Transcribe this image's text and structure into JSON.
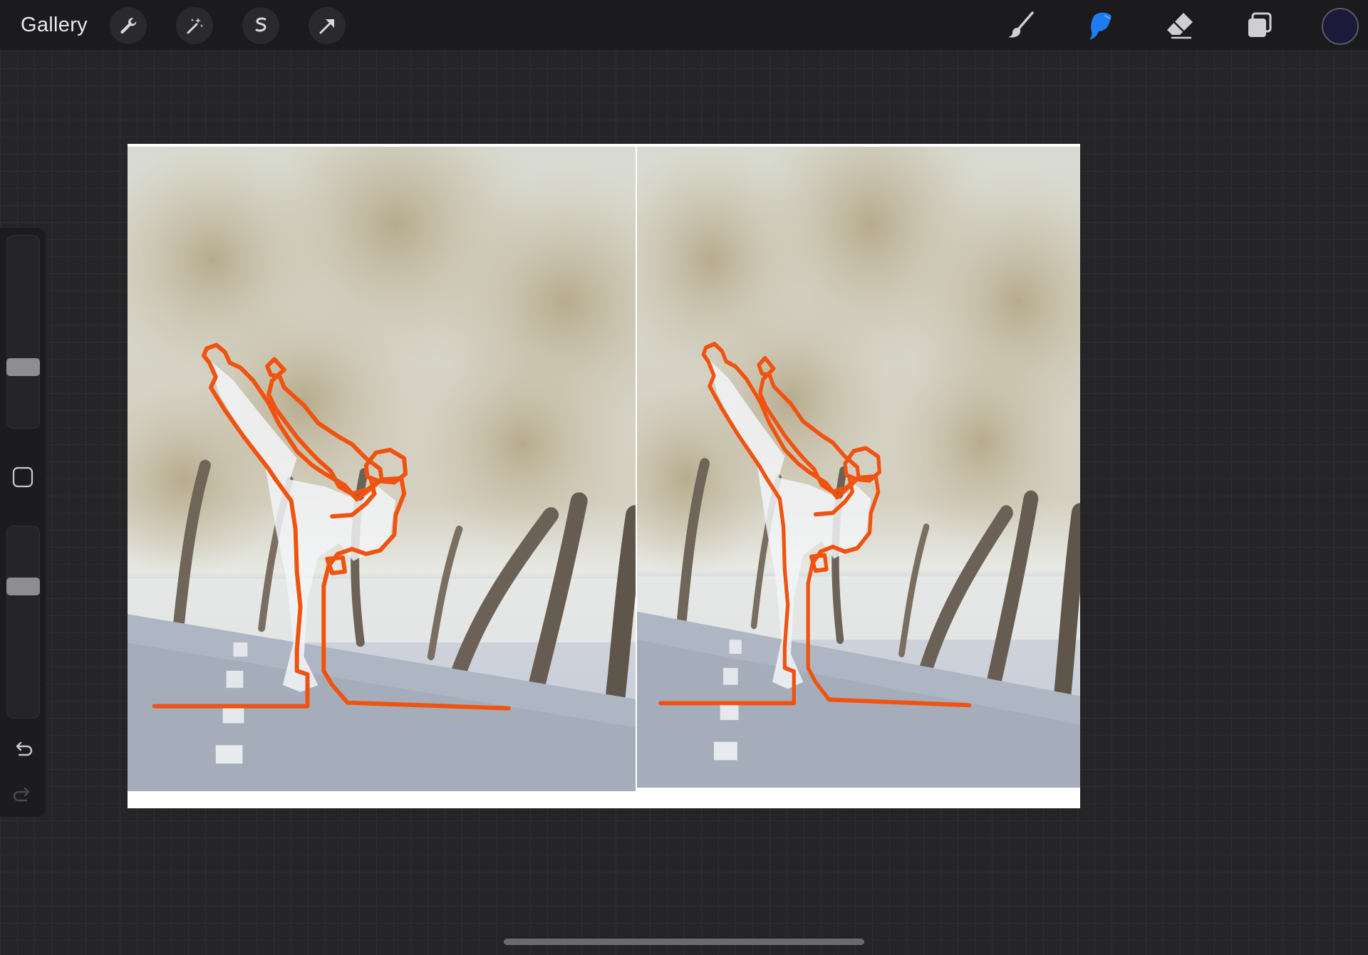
{
  "toolbar": {
    "gallery_label": "Gallery",
    "left_tools": [
      "wrench-icon",
      "magic-wand-icon",
      "selection-s-icon",
      "transform-arrow-icon"
    ],
    "right_tools": [
      "brush-icon",
      "smudge-icon",
      "eraser-icon",
      "layers-icon"
    ],
    "active_tool": "smudge-icon",
    "active_color": "#1b1a3a",
    "accent_color": "#1e7cf2"
  },
  "sidebar": {
    "brush_size_level": 0.29,
    "opacity_level": 0.72,
    "icons": [
      "modify-square-icon",
      "undo-icon",
      "redo-icon"
    ]
  },
  "canvas": {
    "stroke_color": "#f0520f",
    "panels": [
      "left-traced-photo",
      "right-traced-photo"
    ]
  }
}
